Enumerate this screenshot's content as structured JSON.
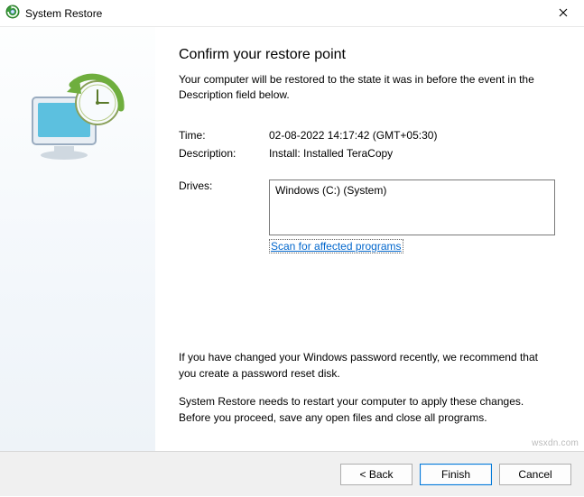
{
  "window": {
    "title": "System Restore"
  },
  "heading": "Confirm your restore point",
  "subtext": "Your computer will be restored to the state it was in before the event in the Description field below.",
  "fields": {
    "time_label": "Time:",
    "time_value": "02-08-2022 14:17:42 (GMT+05:30)",
    "description_label": "Description:",
    "description_value": "Install: Installed TeraCopy",
    "drives_label": "Drives:",
    "drives_value": "Windows (C:) (System)"
  },
  "scan_link": "Scan for affected programs",
  "notes": {
    "password": "If you have changed your Windows password recently, we recommend that you create a password reset disk.",
    "restart": "System Restore needs to restart your computer to apply these changes. Before you proceed, save any open files and close all programs."
  },
  "buttons": {
    "back": "< Back",
    "finish": "Finish",
    "cancel": "Cancel"
  },
  "watermark": "wsxdn.com"
}
